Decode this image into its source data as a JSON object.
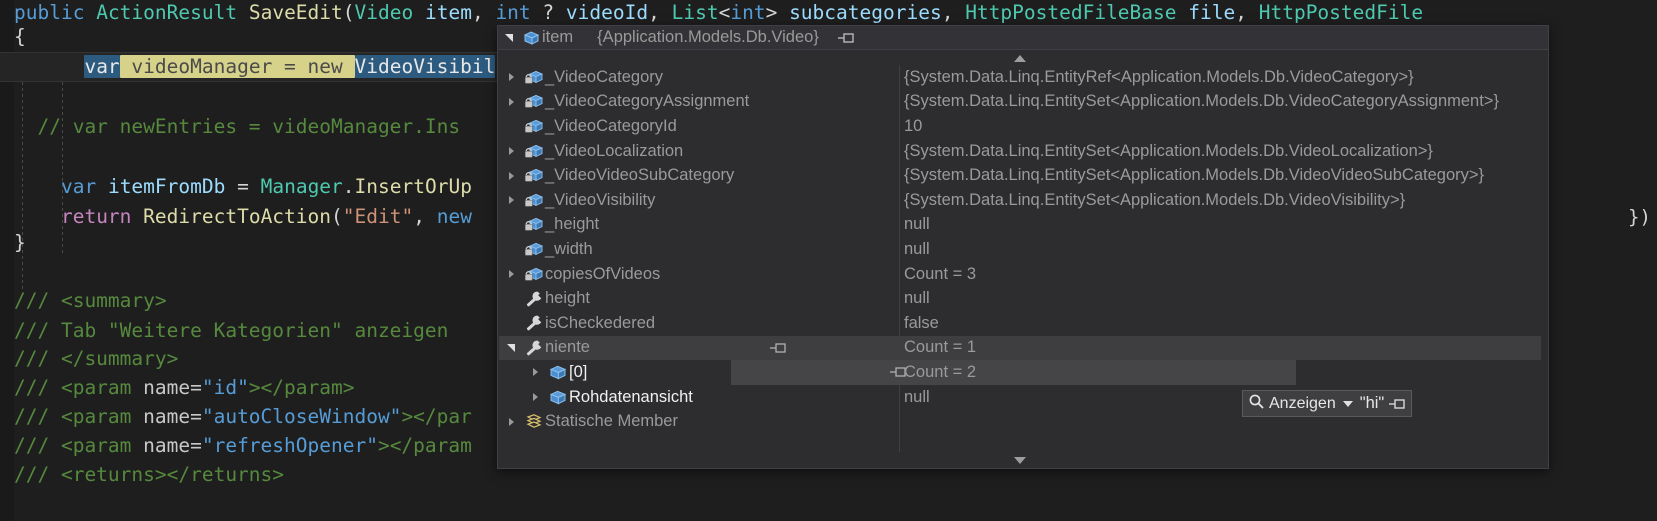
{
  "editor": {
    "language": "csharp",
    "colors": {
      "background": "#1e1e1e",
      "keyword": "#569cd6",
      "type": "#4ec9b0",
      "method": "#dcdcaa",
      "string": "#ce9178",
      "comment": "#56893e",
      "identifier": "#9cdcfe",
      "selection": "#2d5b80",
      "rename_highlight": "#d7d28a"
    },
    "lines": [
      {
        "id": "l1",
        "text": "public ActionResult SaveEdit(Video item, int ? videoId, List<int> subcategories, HttpPostedFileBase file, HttpPostedFile"
      },
      {
        "id": "l2",
        "text": "{"
      },
      {
        "id": "l3",
        "text": "        var videoManager = new VideoVisibil"
      },
      {
        "id": "l4",
        "text": ""
      },
      {
        "id": "l5",
        "text": "     // var newEntries = videoManager.Ins"
      },
      {
        "id": "l6",
        "text": ""
      },
      {
        "id": "l7",
        "text": "        var itemFromDb = Manager.InsertOrUp"
      },
      {
        "id": "l8",
        "text": "        return RedirectToAction(\"Edit\", new"
      },
      {
        "id": "l9",
        "text": "}"
      },
      {
        "id": "l10",
        "text": ""
      },
      {
        "id": "l11",
        "text": "/// <summary>"
      },
      {
        "id": "l12",
        "text": "/// Tab \"Weitere Kategorien\" anzeigen"
      },
      {
        "id": "l13",
        "text": "/// </summary>"
      },
      {
        "id": "l14",
        "text": "/// <param name=\"id\"></param>"
      },
      {
        "id": "l15",
        "text": "/// <param name=\"autoCloseWindow\"></par"
      },
      {
        "id": "l16",
        "text": "/// <param name=\"refreshOpener\"></param"
      },
      {
        "id": "l17",
        "text": "/// <returns></returns>"
      }
    ],
    "signature": {
      "modifier": "public",
      "return_type": "ActionResult",
      "name": "SaveEdit",
      "params": [
        "Video item",
        "int ? videoId",
        "List<int> subcategories",
        "HttpPostedFileBase file",
        "HttpPostedFile"
      ]
    },
    "line3": {
      "var_kw": "var",
      "selected_name": "videoManager",
      "equals": "=",
      "new_kw": "new",
      "type_partial": "VideoVisibil"
    },
    "line5_comment": "// var newEntries = videoManager.Ins",
    "line7": {
      "var_kw": "var",
      "name": "itemFromDb",
      "eq": "=",
      "recv": "Manager",
      "dot": ".",
      "call": "InsertOrUp"
    },
    "line8": {
      "kw": "return",
      "call": "RedirectToAction",
      "open": "(",
      "str": "\"Edit\"",
      "comma": ", ",
      "new": "new"
    },
    "doc_lines": [
      {
        "slashes": "///",
        "tag": " <summary>"
      },
      {
        "slashes": "///",
        "tag": " Tab \"Weitere Kategorien\" anzeigen"
      },
      {
        "slashes": "///",
        "tag": " </summary>"
      },
      {
        "slashes": "///",
        "tag": " <param name=",
        "val": "\"id\"",
        "tail": "></param>"
      },
      {
        "slashes": "///",
        "tag": " <param name=",
        "val": "\"autoCloseWindow\"",
        "tail": "></par"
      },
      {
        "slashes": "///",
        "tag": " <param name=",
        "val": "\"refreshOpener\"",
        "tail": "></param"
      },
      {
        "slashes": "///",
        "tag": " <returns></returns>"
      }
    ],
    "far_right_fragment": "})"
  },
  "datatip": {
    "header": {
      "expander": "expanded",
      "icon": "object-cube-icon",
      "name": "item",
      "type": "{Application.Models.Db.Video}",
      "pin_tooltip": "pin-icon"
    },
    "scroll_up_icon": "scroll-up-arrow",
    "scroll_down_icon": "scroll-down-arrow",
    "rows": [
      {
        "expandable": true,
        "icon": "field-icon",
        "name": "_VideoCategory",
        "value": "{System.Data.Linq.EntityRef<Application.Models.Db.VideoCategory>}",
        "indent": 0,
        "selected": false
      },
      {
        "expandable": true,
        "icon": "field-icon",
        "name": "_VideoCategoryAssignment",
        "value": "{System.Data.Linq.EntitySet<Application.Models.Db.VideoCategoryAssignment>}",
        "indent": 0,
        "selected": false
      },
      {
        "expandable": false,
        "icon": "field-icon",
        "name": "_VideoCategoryId",
        "value": "10",
        "indent": 0,
        "selected": false
      },
      {
        "expandable": true,
        "icon": "field-icon",
        "name": "_VideoLocalization",
        "value": "{System.Data.Linq.EntitySet<Application.Models.Db.VideoLocalization>}",
        "indent": 0,
        "selected": false
      },
      {
        "expandable": true,
        "icon": "field-icon",
        "name": "_VideoVideoSubCategory",
        "value": "{System.Data.Linq.EntitySet<Application.Models.Db.VideoVideoSubCategory>}",
        "indent": 0,
        "selected": false
      },
      {
        "expandable": true,
        "icon": "field-icon",
        "name": "_VideoVisibility",
        "value": "{System.Data.Linq.EntitySet<Application.Models.Db.VideoVisibility>}",
        "indent": 0,
        "selected": false
      },
      {
        "expandable": false,
        "icon": "field-icon",
        "name": "_height",
        "value": "null",
        "indent": 0,
        "selected": false
      },
      {
        "expandable": false,
        "icon": "field-icon",
        "name": "_width",
        "value": "null",
        "indent": 0,
        "selected": false
      },
      {
        "expandable": true,
        "icon": "field-icon",
        "name": "copiesOfVideos",
        "value": "Count = 3",
        "indent": 0,
        "selected": false
      },
      {
        "expandable": false,
        "icon": "property-icon",
        "name": "height",
        "value": "null",
        "indent": 0,
        "selected": false
      },
      {
        "expandable": false,
        "icon": "property-icon",
        "name": "isCheckedered",
        "value": "false",
        "indent": 0,
        "selected": false
      },
      {
        "expandable": true,
        "expanded": true,
        "icon": "property-icon",
        "name": "niente",
        "value": "Count = 1",
        "indent": 0,
        "selected": true,
        "pin": true
      },
      {
        "expandable": true,
        "icon": "object-cube-icon",
        "name": "[0]",
        "value": "Count = 2",
        "indent": 1,
        "selected": false,
        "bright": true,
        "hovered": true,
        "pin": true
      },
      {
        "expandable": true,
        "icon": "object-cube-icon",
        "name": "Rohdatenansicht",
        "value": "null",
        "indent": 1,
        "selected": false,
        "bright": true
      },
      {
        "expandable": true,
        "icon": "static-members-icon",
        "name": "Statische Member",
        "value": "",
        "indent": 0,
        "selected": false
      }
    ],
    "visualizer": {
      "magnifier_icon": "magnifier-icon",
      "label": "Anzeigen",
      "caret_icon": "chevron-down-icon",
      "value": "\"hi\"",
      "pin_icon": "pin-icon"
    }
  }
}
